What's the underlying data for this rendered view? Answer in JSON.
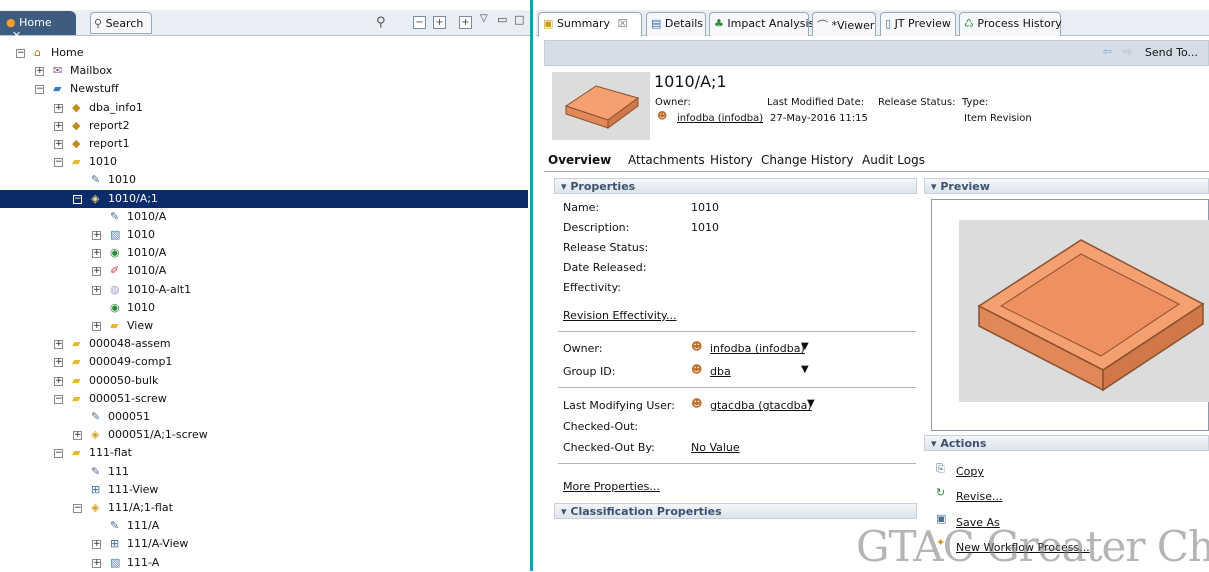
{
  "left": {
    "home_tab": "Home",
    "search_tab": "Search",
    "tree": [
      {
        "label": "Home",
        "indent": 0,
        "exp": "−",
        "icon": "home-folder"
      },
      {
        "label": "Mailbox",
        "indent": 1,
        "exp": "+",
        "icon": "mailbox"
      },
      {
        "label": "Newstuff",
        "indent": 1,
        "exp": "−",
        "icon": "newstuff-folder"
      },
      {
        "label": "dba_info1",
        "indent": 2,
        "exp": "+",
        "icon": "query"
      },
      {
        "label": "report2",
        "indent": 2,
        "exp": "+",
        "icon": "query"
      },
      {
        "label": "report1",
        "indent": 2,
        "exp": "+",
        "icon": "query"
      },
      {
        "label": "1010",
        "indent": 2,
        "exp": "−",
        "icon": "item"
      },
      {
        "label": "1010",
        "indent": 3,
        "exp": "",
        "icon": "form"
      },
      {
        "label": "1010/A;1",
        "indent": 3,
        "exp": "−",
        "icon": "revision",
        "sel": true
      },
      {
        "label": "1010/A",
        "indent": 4,
        "exp": "",
        "icon": "form"
      },
      {
        "label": "1010",
        "indent": 4,
        "exp": "+",
        "icon": "dataset"
      },
      {
        "label": "1010/A",
        "indent": 4,
        "exp": "+",
        "icon": "bom"
      },
      {
        "label": "1010/A",
        "indent": 4,
        "exp": "+",
        "icon": "drawing"
      },
      {
        "label": "1010-A-alt1",
        "indent": 4,
        "exp": "+",
        "icon": "alt"
      },
      {
        "label": "1010",
        "indent": 4,
        "exp": "",
        "icon": "bom"
      },
      {
        "label": "View",
        "indent": 4,
        "exp": "+",
        "icon": "view-folder"
      },
      {
        "label": "000048-assem",
        "indent": 2,
        "exp": "+",
        "icon": "item"
      },
      {
        "label": "000049-comp1",
        "indent": 2,
        "exp": "+",
        "icon": "item"
      },
      {
        "label": "000050-bulk",
        "indent": 2,
        "exp": "+",
        "icon": "item"
      },
      {
        "label": "000051-screw",
        "indent": 2,
        "exp": "−",
        "icon": "item"
      },
      {
        "label": "000051",
        "indent": 3,
        "exp": "",
        "icon": "form"
      },
      {
        "label": "000051/A;1-screw",
        "indent": 3,
        "exp": "+",
        "icon": "revision"
      },
      {
        "label": "111-flat",
        "indent": 2,
        "exp": "−",
        "icon": "item"
      },
      {
        "label": "111",
        "indent": 3,
        "exp": "",
        "icon": "form"
      },
      {
        "label": "111-View",
        "indent": 3,
        "exp": "",
        "icon": "view"
      },
      {
        "label": "111/A;1-flat",
        "indent": 3,
        "exp": "−",
        "icon": "revision"
      },
      {
        "label": "111/A",
        "indent": 4,
        "exp": "",
        "icon": "form"
      },
      {
        "label": "111/A-View",
        "indent": 4,
        "exp": "+",
        "icon": "view"
      },
      {
        "label": "111-A",
        "indent": 4,
        "exp": "+",
        "icon": "dataset"
      }
    ]
  },
  "right": {
    "tabs": [
      "Summary",
      "Details",
      "Impact Analysis",
      "*Viewer",
      "JT Preview",
      "Process History"
    ],
    "send_to": "Send To...",
    "object": {
      "title": "1010/A;1",
      "owner_label": "Owner:",
      "owner_value": "infodba (infodba)",
      "last_mod_label": "Last Modified Date:",
      "last_mod_value": "27-May-2016 11:15",
      "release_label": "Release Status:",
      "type_label": "Type:",
      "type_value": "Item Revision"
    },
    "object_tabs": [
      "Overview",
      "Attachments",
      "History",
      "Change History",
      "Audit Logs"
    ],
    "properties": {
      "header": "Properties",
      "name_label": "Name:",
      "name_value": "1010",
      "desc_label": "Description:",
      "desc_value": "1010",
      "release_label": "Release Status:",
      "date_label": "Date Released:",
      "eff_label": "Effectivity:",
      "rev_eff_link": "Revision Effectivity...",
      "owner_label": "Owner:",
      "owner_value": "infodba (infodba)",
      "group_label": "Group ID:",
      "group_value": "dba",
      "lmu_label": "Last Modifying User:",
      "lmu_value": "gtacdba (gtacdba)",
      "checked_out_label": "Checked-Out:",
      "checked_out_by_label": "Checked-Out By:",
      "checked_out_by_value": "No Value",
      "more_link": "More Properties..."
    },
    "classification_header": "Classification Properties",
    "preview_header": "Preview",
    "actions": {
      "header": "Actions",
      "copy": "Copy",
      "revise": "Revise...",
      "save_as": "Save As",
      "new_workflow": "New Workflow Process..."
    },
    "watermark": "GTAC Greater Chi"
  }
}
